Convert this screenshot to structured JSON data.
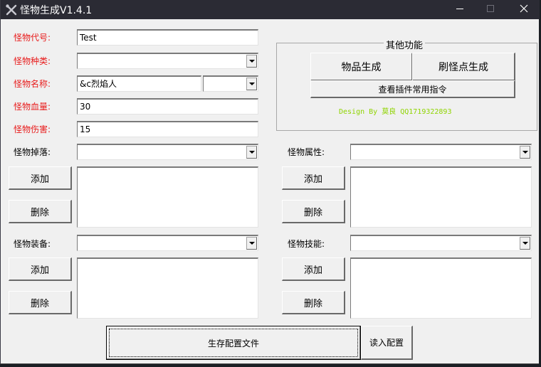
{
  "window": {
    "title": "怪物生成V1.4.1",
    "controls": {
      "minimize": "minimize",
      "maximize": "maximize",
      "close": "close"
    }
  },
  "basic": {
    "code_label": "怪物代号:",
    "code_value": "Test",
    "type_label": "怪物种类:",
    "type_value": "",
    "name_label": "怪物名称:",
    "name_value": "&c烈焰人",
    "name_color_value": "",
    "hp_label": "怪物血量:",
    "hp_value": "30",
    "damage_label": "怪物伤害:",
    "damage_value": "15",
    "label_color": "#e81c1c"
  },
  "other": {
    "group_title": "其他功能",
    "item_gen_button": "物品生成",
    "spawner_gen_button": "刷怪点生成",
    "commands_button": "查看插件常用指令",
    "credit": "Design By 莫良 QQ1719322893",
    "credit_color": "#8fd400"
  },
  "sections": {
    "drops": {
      "label": "怪物掉落:",
      "value": "",
      "add": "添加",
      "remove": "删除",
      "items": []
    },
    "attributes": {
      "label": "怪物属性:",
      "value": "",
      "add": "添加",
      "remove": "删除",
      "items": []
    },
    "equipment": {
      "label": "怪物装备:",
      "value": "",
      "add": "添加",
      "remove": "删除",
      "items": []
    },
    "skills": {
      "label": "怪物技能:",
      "value": "",
      "add": "添加",
      "remove": "删除",
      "items": []
    }
  },
  "footer": {
    "save_button": "生存配置文件",
    "load_button": "读入配置"
  }
}
